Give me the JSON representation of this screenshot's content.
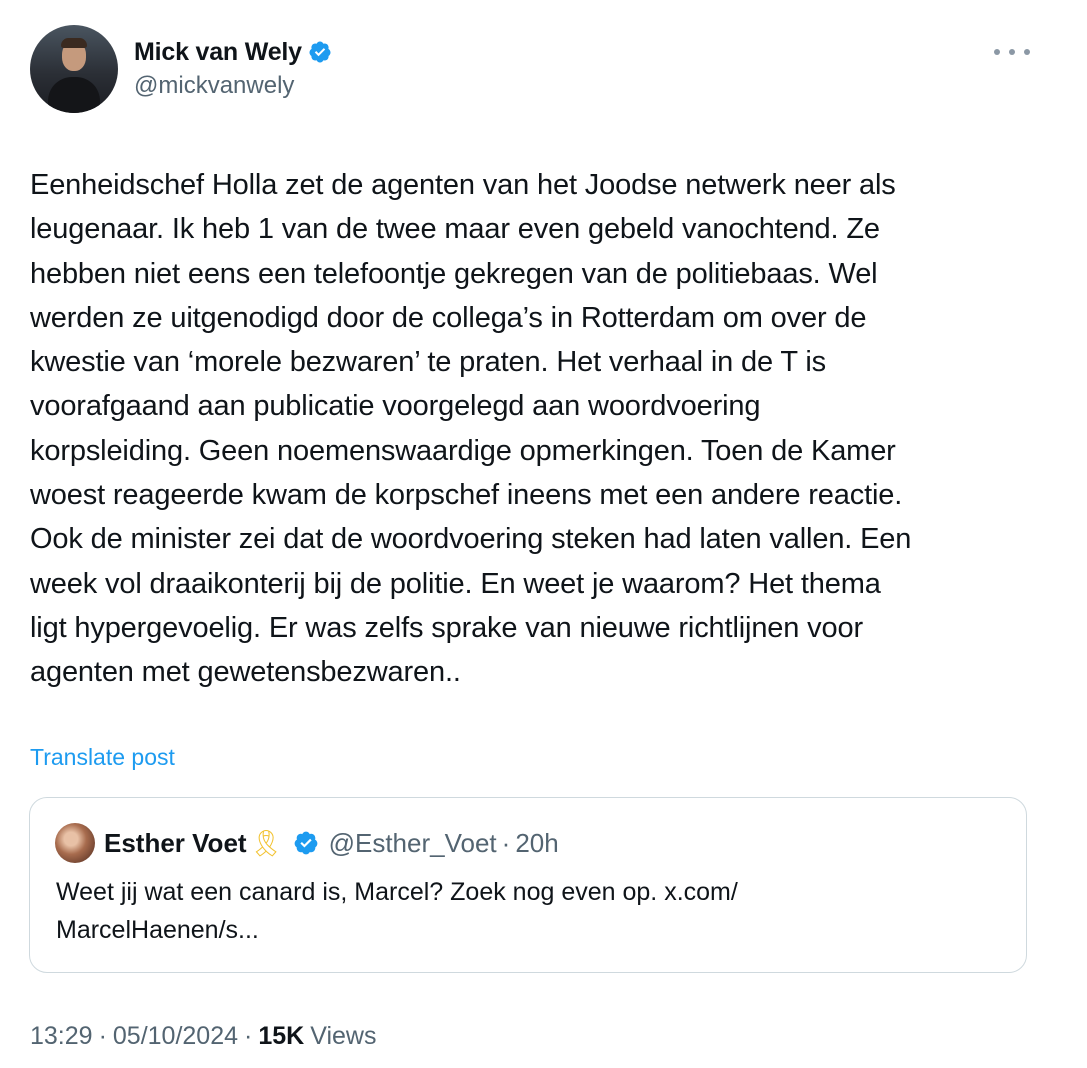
{
  "author": {
    "display_name": "Mick van Wely",
    "handle": "@mickvanwely",
    "verified_icon": "verified-badge-icon",
    "avatar_icon": "profile-photo"
  },
  "tweet": {
    "text": "Eenheidschef Holla zet de agenten van het Joodse netwerk neer als\nleugenaar. Ik heb 1 van de twee maar even gebeld vanochtend. Ze\nhebben niet eens een telefoontje gekregen van de politiebaas. Wel\nwerden ze uitgenodigd door de collega’s in Rotterdam om over de\nkwestie van ‘morele bezwaren’ te praten. Het verhaal in de T is\nvoorafgaand aan publicatie voorgelegd aan woordvoering\nkorpsleiding. Geen noemenswaardige opmerkingen. Toen de Kamer\nwoest reageerde kwam de korpschef ineens met een andere reactie.\nOok de minister zei dat de woordvoering steken had laten vallen. Een\nweek vol draaikonterij bij de politie. En weet je waarom? Het thema\nligt hypergevoelig. Er was zelfs sprake van nieuwe richtlijnen voor\nagenten met gewetensbezwaren..",
    "translate_label": "Translate post",
    "more_icon": "more-options-icon"
  },
  "quoted_tweet": {
    "display_name": "Esther Voet",
    "emoji": "🎗",
    "handle": "@Esther_Voet",
    "separator": "·",
    "time": "20h",
    "text": "Weet jij wat een canard is, Marcel? Zoek nog even op. x.com/\nMarcelHaenen/s..."
  },
  "meta": {
    "time": "13:29",
    "separator1": "·",
    "date": "05/10/2024",
    "separator2": "·",
    "views_count": "15K",
    "views_label": "Views"
  },
  "colors": {
    "accent": "#1d9bf0",
    "text_primary": "#0f1419",
    "text_secondary": "#536471",
    "border": "#cfd9de",
    "ribbon": "#f2c230"
  }
}
